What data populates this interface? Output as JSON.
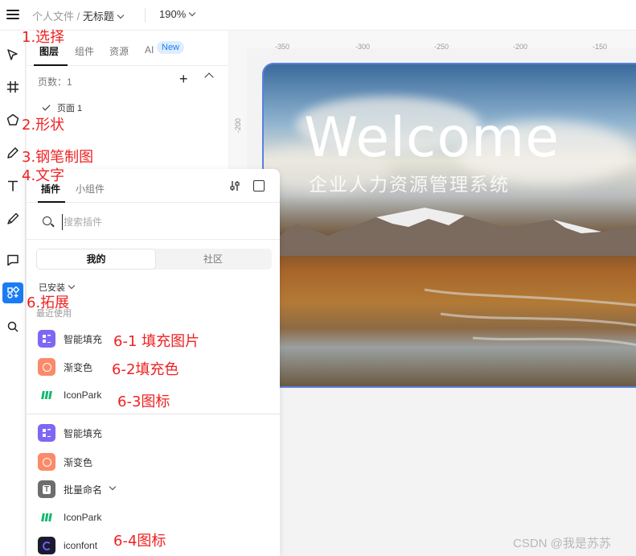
{
  "topbar": {
    "breadcrumb_path": "个人文件 /",
    "file_name": "无标题",
    "zoom": "190%"
  },
  "layers_panel": {
    "tabs": [
      {
        "label": "图层"
      },
      {
        "label": "组件"
      },
      {
        "label": "资源"
      },
      {
        "label": "AI"
      }
    ],
    "new_badge": "New",
    "page_count": "页数：1",
    "page_item": "页面 1"
  },
  "canvas": {
    "ruler_top": [
      "-350",
      "-300",
      "-250",
      "-200",
      "-150"
    ],
    "ruler_left": "-200",
    "hero_title": "Welcome",
    "hero_subtitle": "企业人力资源管理系统"
  },
  "plugins_panel": {
    "tabs": [
      {
        "label": "插件"
      },
      {
        "label": "小组件"
      }
    ],
    "search_placeholder": "搜索插件",
    "segment": {
      "mine": "我的",
      "community": "社区"
    },
    "installed_label": "已安装",
    "recent_label": "最近使用",
    "items": [
      {
        "label": "智能填充",
        "icon": "smart-fill-icon"
      },
      {
        "label": "渐变色",
        "icon": "gradient-icon"
      },
      {
        "label": "IconPark",
        "icon": "iconpark-icon"
      },
      {
        "label": "智能填充",
        "icon": "smart-fill-icon"
      },
      {
        "label": "渐变色",
        "icon": "gradient-icon"
      },
      {
        "label": "批量命名",
        "icon": "batch-rename-icon"
      },
      {
        "label": "IconPark",
        "icon": "iconpark-icon"
      },
      {
        "label": "iconfont",
        "icon": "iconfont-icon"
      }
    ]
  },
  "annotations": {
    "select": "1.选择",
    "shape": "2.形状",
    "pen": "3.钢笔制图",
    "text": "4.文字",
    "extend": "6.拓展",
    "fill_image": "6-1 填充图片",
    "fill_color": "6-2填充色",
    "icon_a": "6-3图标",
    "icon_b": "6-4图标"
  },
  "watermark": "CSDN @我是苏苏",
  "colors": {
    "accent": "#1a7cf5",
    "annotation": "#ee2222",
    "frame_border": "#5b7fe0"
  }
}
